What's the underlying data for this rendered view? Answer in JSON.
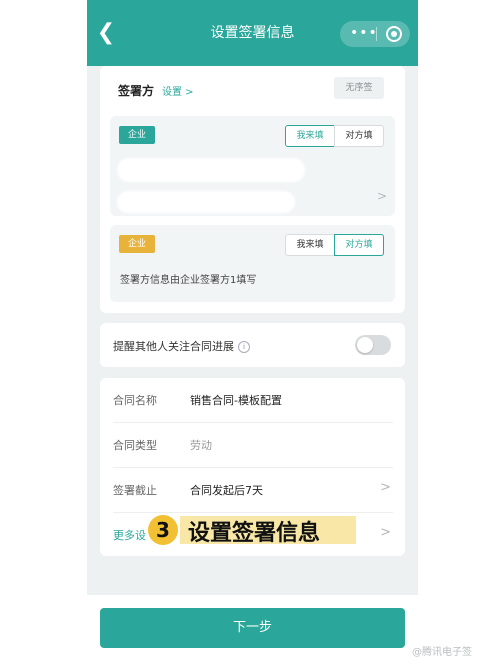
{
  "header": {
    "title": "设置签署信息",
    "back_icon": "back-chevron-icon",
    "more_icon": "more-dots-icon",
    "close_icon": "capsule-circle-icon"
  },
  "signer_section": {
    "label": "签署方",
    "settings_link": "设置 >",
    "no_order_button": "无序签",
    "parties": [
      {
        "type_tag": "企业",
        "tag_color": "#2aa79a",
        "options": [
          "我来填",
          "对方填"
        ],
        "selected": "我来填"
      },
      {
        "type_tag": "企业",
        "tag_color": "#e8b33a",
        "options": [
          "我来填",
          "对方填"
        ],
        "selected": "对方填",
        "note": "签署方信息由企业签署方1填写"
      }
    ]
  },
  "remind": {
    "label": "提醒其他人关注合同进展",
    "enabled": false
  },
  "contract": {
    "rows": [
      {
        "label": "合同名称",
        "value": "销售合同-模板配置"
      },
      {
        "label": "合同类型",
        "value": "劳动"
      },
      {
        "label": "签署截止",
        "value": "合同发起后7天"
      },
      {
        "label": "更多设"
      }
    ]
  },
  "overlay": {
    "number": "3",
    "text": "设置签署信息"
  },
  "footer": {
    "next_button": "下一步"
  },
  "watermark": "@腾讯电子签",
  "colors": {
    "accent": "#2aa79a",
    "highlight": "#f2c033"
  }
}
